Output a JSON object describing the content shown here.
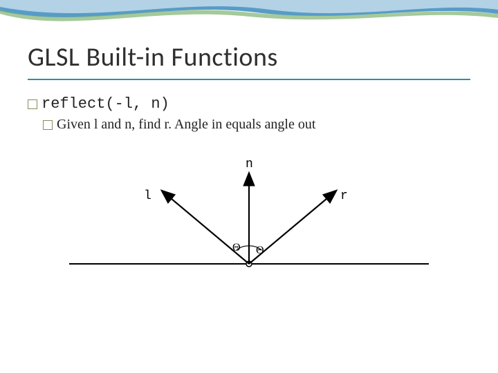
{
  "slide": {
    "title": "GLSL Built-in Functions",
    "bullet1_code": "reflect(-l, n)",
    "bullet2_desc": "Given l and n, find r. Angle in equals angle out"
  },
  "diagram": {
    "label_l": "l",
    "label_n": "n",
    "label_r": "r",
    "theta_left": "Θ",
    "theta_right": "Θ"
  },
  "theme": {
    "accent": "#2b8fa3",
    "wave_blue": "#3a8bbd",
    "wave_green": "#7fb26f"
  }
}
